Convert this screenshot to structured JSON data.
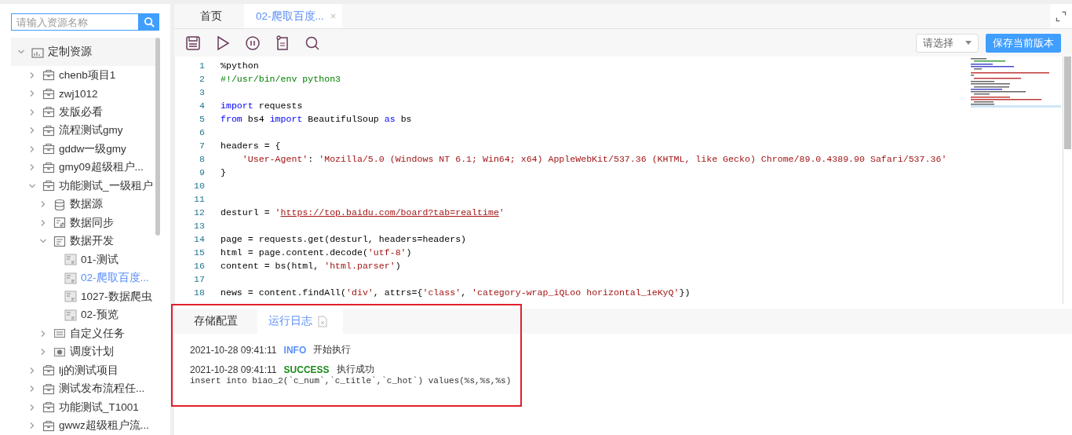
{
  "sidebar": {
    "search": {
      "placeholder": "请输入资源名称"
    },
    "tree": [
      {
        "label": "定制资源",
        "kind": "root",
        "expanded": true,
        "selected": false,
        "children": [
          {
            "label": "chenb项目1",
            "kind": "project",
            "expanded": false,
            "selected": false
          },
          {
            "label": "zwj1012",
            "kind": "project",
            "expanded": false,
            "selected": false
          },
          {
            "label": "发版必看",
            "kind": "project",
            "expanded": false,
            "selected": false
          },
          {
            "label": "流程测试gmy",
            "kind": "project",
            "expanded": false,
            "selected": false
          },
          {
            "label": "gddw一级gmy",
            "kind": "project",
            "expanded": false,
            "selected": false
          },
          {
            "label": "gmy09超级租户...",
            "kind": "project",
            "expanded": false,
            "selected": false
          },
          {
            "label": "功能测试_一级租户",
            "kind": "project",
            "expanded": true,
            "selected": false,
            "children": [
              {
                "label": "数据源",
                "kind": "database",
                "expanded": false,
                "selected": false
              },
              {
                "label": "数据同步",
                "kind": "sync",
                "expanded": false,
                "selected": false
              },
              {
                "label": "数据开发",
                "kind": "develop",
                "expanded": true,
                "selected": false,
                "children": [
                  {
                    "label": "01-测试",
                    "kind": "script",
                    "selected": false
                  },
                  {
                    "label": "02-爬取百度...",
                    "kind": "script",
                    "selected": true
                  },
                  {
                    "label": "1027-数据爬虫",
                    "kind": "script",
                    "selected": false
                  },
                  {
                    "label": "02-预览",
                    "kind": "script",
                    "selected": false
                  }
                ]
              },
              {
                "label": "自定义任务",
                "kind": "task",
                "expanded": false,
                "selected": false
              },
              {
                "label": "调度计划",
                "kind": "schedule",
                "expanded": false,
                "selected": false
              }
            ]
          },
          {
            "label": "lj的测试项目",
            "kind": "project",
            "expanded": false,
            "selected": false
          },
          {
            "label": "测试发布流程任...",
            "kind": "project",
            "expanded": false,
            "selected": false
          },
          {
            "label": "功能测试_T1001",
            "kind": "project",
            "expanded": false,
            "selected": false
          },
          {
            "label": "gwwz超级租户流...",
            "kind": "project",
            "expanded": false,
            "selected": false
          }
        ]
      }
    ]
  },
  "tabs": [
    {
      "label": "首页",
      "selected": false
    },
    {
      "label": "02-爬取百度...",
      "selected": true,
      "close": "×"
    }
  ],
  "toolbar": {
    "tools": [
      {
        "kind": "save"
      },
      {
        "kind": "run"
      },
      {
        "kind": "pause"
      },
      {
        "kind": "clipboard"
      },
      {
        "kind": "search"
      }
    ],
    "version_select": {
      "placeholder": "请选择"
    },
    "save_version_button": "保存当前版本"
  },
  "editor": {
    "lines": [
      {
        "number": "1",
        "tokens": [
          {
            "t": "%python",
            "kind": "plain"
          }
        ]
      },
      {
        "number": "2",
        "tokens": [
          {
            "t": "#!/usr/bin/env python3",
            "kind": "comment"
          }
        ]
      },
      {
        "number": "3"
      },
      {
        "number": "4",
        "tokens": [
          {
            "t": "import",
            "kind": "keyword"
          },
          {
            "t": " requests",
            "kind": "plain"
          }
        ]
      },
      {
        "number": "5",
        "tokens": [
          {
            "t": "from",
            "kind": "keyword"
          },
          {
            "t": " bs4 ",
            "kind": "plain"
          },
          {
            "t": "import",
            "kind": "keyword"
          },
          {
            "t": " BeautifulSoup ",
            "kind": "plain"
          },
          {
            "t": "as",
            "kind": "keyword"
          },
          {
            "t": " bs",
            "kind": "plain"
          }
        ]
      },
      {
        "number": "6"
      },
      {
        "number": "7",
        "tokens": [
          {
            "t": "headers = {",
            "kind": "plain"
          }
        ]
      },
      {
        "number": "8",
        "tokens": [
          {
            "t": "    'User-Agent'",
            "kind": "string"
          },
          {
            "t": ": ",
            "kind": "plain"
          },
          {
            "t": "'Mozilla/5.0 (Windows NT 6.1; Win64; x64) AppleWebKit/537.36 (KHTML, like Gecko) Chrome/89.0.4389.90 Safari/537.36'",
            "kind": "string"
          }
        ]
      },
      {
        "number": "9",
        "tokens": [
          {
            "t": "}",
            "kind": "plain"
          }
        ]
      },
      {
        "number": "10"
      },
      {
        "number": "11"
      },
      {
        "number": "12",
        "tokens": [
          {
            "t": "desturl = ",
            "kind": "plain"
          },
          {
            "t": "'",
            "kind": "string"
          },
          {
            "t": "https://top.baidu.com/board?tab=realtime",
            "kind": "link"
          },
          {
            "t": "'",
            "kind": "string"
          }
        ]
      },
      {
        "number": "13"
      },
      {
        "number": "14",
        "tokens": [
          {
            "t": "page = requests.get(desturl, headers=headers)",
            "kind": "plain"
          }
        ]
      },
      {
        "number": "15",
        "tokens": [
          {
            "t": "html = page.content.decode(",
            "kind": "plain"
          },
          {
            "t": "'utf-8'",
            "kind": "string"
          },
          {
            "t": ")",
            "kind": "plain"
          }
        ]
      },
      {
        "number": "16",
        "tokens": [
          {
            "t": "content = bs(html, ",
            "kind": "plain"
          },
          {
            "t": "'html.parser'",
            "kind": "string"
          },
          {
            "t": ")",
            "kind": "plain"
          }
        ]
      },
      {
        "number": "17"
      },
      {
        "number": "18",
        "tokens": [
          {
            "t": "news = content.findAll(",
            "kind": "plain"
          },
          {
            "t": "'div'",
            "kind": "string"
          },
          {
            "t": ", attrs={",
            "kind": "plain"
          },
          {
            "t": "'class'",
            "kind": "string"
          },
          {
            "t": ", ",
            "kind": "plain"
          },
          {
            "t": "'category-wrap_iQLoo horizontal_1eKyQ'",
            "kind": "string"
          },
          {
            "t": "})",
            "kind": "plain"
          }
        ]
      }
    ]
  },
  "bottom_panel": {
    "highlighted": true,
    "tabs": [
      {
        "label": "存储配置",
        "selected": false,
        "icon": false
      },
      {
        "label": "运行日志",
        "selected": true,
        "icon": true
      }
    ],
    "log": [
      {
        "time": "2021-10-28 09:41:11",
        "level": "INFO",
        "kind": "info",
        "message": "开始执行"
      },
      {
        "time": "2021-10-28 09:41:11",
        "level": "SUCCESS",
        "kind": "success",
        "message": "执行成功",
        "detail": "insert into biao_2(`c_num`,`c_title`,`c_hot`) values(%s,%s,%s)"
      }
    ]
  }
}
